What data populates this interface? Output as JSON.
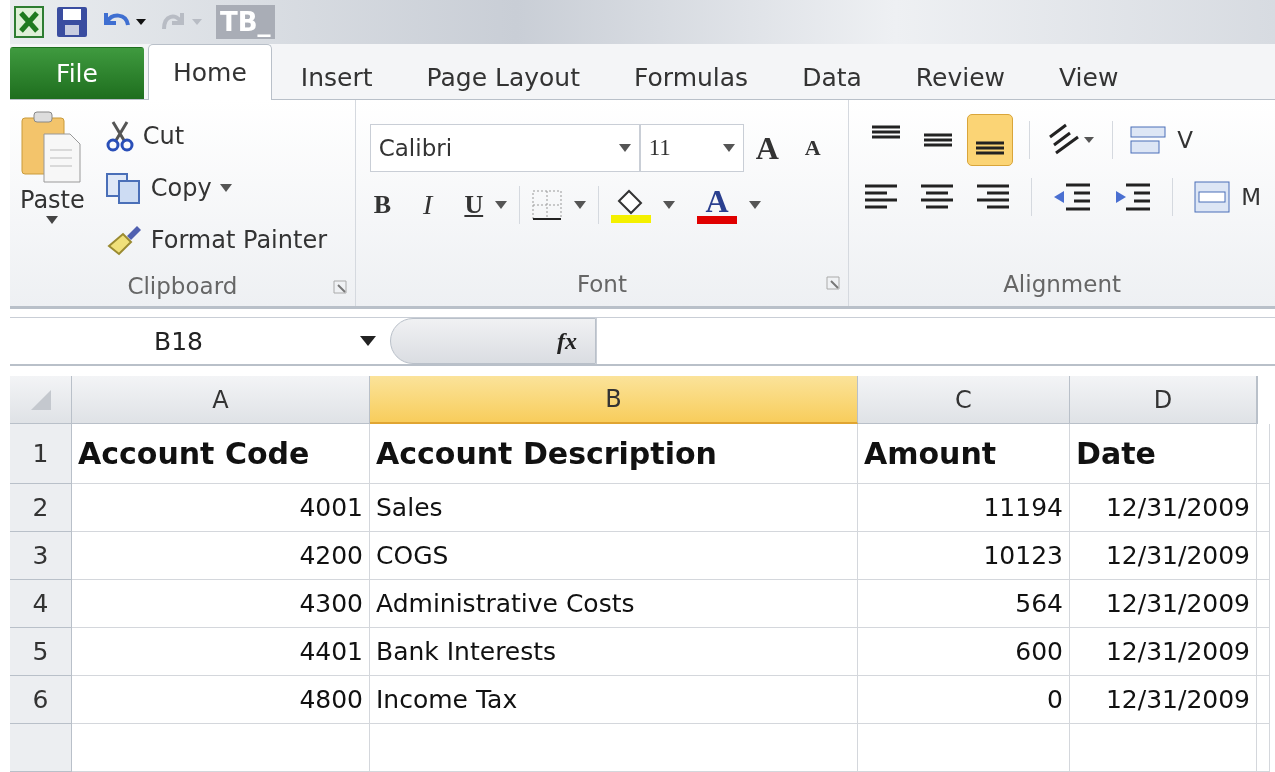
{
  "title_bar": {
    "title": "TB_"
  },
  "tabs": [
    {
      "label": "File",
      "kind": "file",
      "selected": false
    },
    {
      "label": "Home",
      "kind": "tab",
      "selected": true
    },
    {
      "label": "Insert",
      "kind": "tab",
      "selected": false
    },
    {
      "label": "Page Layout",
      "kind": "tab",
      "selected": false
    },
    {
      "label": "Formulas",
      "kind": "tab",
      "selected": false
    },
    {
      "label": "Data",
      "kind": "tab",
      "selected": false
    },
    {
      "label": "Review",
      "kind": "tab",
      "selected": false
    },
    {
      "label": "View",
      "kind": "tab",
      "selected": false
    }
  ],
  "ribbon": {
    "clipboard": {
      "paste": "Paste",
      "cut": "Cut",
      "copy": "Copy",
      "format_painter": "Format Painter",
      "label": "Clipboard"
    },
    "font": {
      "name": "Calibri",
      "size": "11",
      "grow": "A",
      "shrink": "A",
      "bold": "B",
      "italic": "I",
      "underline": "U",
      "font_color": "A",
      "label": "Font"
    },
    "alignment": {
      "vertical": [
        {
          "kind": "top",
          "selected": false
        },
        {
          "kind": "middle",
          "selected": false
        },
        {
          "kind": "bottom",
          "selected": true
        }
      ],
      "wrap": "V",
      "merge": "M",
      "label": "Alignment"
    }
  },
  "formula_bar": {
    "name_box": "B18",
    "fx": "fx"
  },
  "sheet": {
    "columns": [
      {
        "label": "A",
        "selected": false
      },
      {
        "label": "B",
        "selected": true
      },
      {
        "label": "C",
        "selected": false
      },
      {
        "label": "D",
        "selected": false
      }
    ],
    "rows": [
      {
        "number": "1",
        "kind": "header",
        "cells": [
          "Account Code",
          "Account Description",
          "Amount",
          "Date"
        ]
      },
      {
        "number": "2",
        "kind": "data",
        "cells": [
          "4001",
          "Sales",
          "11194",
          "12/31/2009"
        ]
      },
      {
        "number": "3",
        "kind": "data",
        "cells": [
          "4200",
          "COGS",
          "10123",
          "12/31/2009"
        ]
      },
      {
        "number": "4",
        "kind": "data",
        "cells": [
          "4300",
          "Administrative Costs",
          "564",
          "12/31/2009"
        ]
      },
      {
        "number": "5",
        "kind": "data",
        "cells": [
          "4401",
          "Bank Interests",
          "600",
          "12/31/2009"
        ]
      },
      {
        "number": "6",
        "kind": "data",
        "cells": [
          "4800",
          "Income Tax",
          "0",
          "12/31/2009"
        ]
      }
    ]
  }
}
